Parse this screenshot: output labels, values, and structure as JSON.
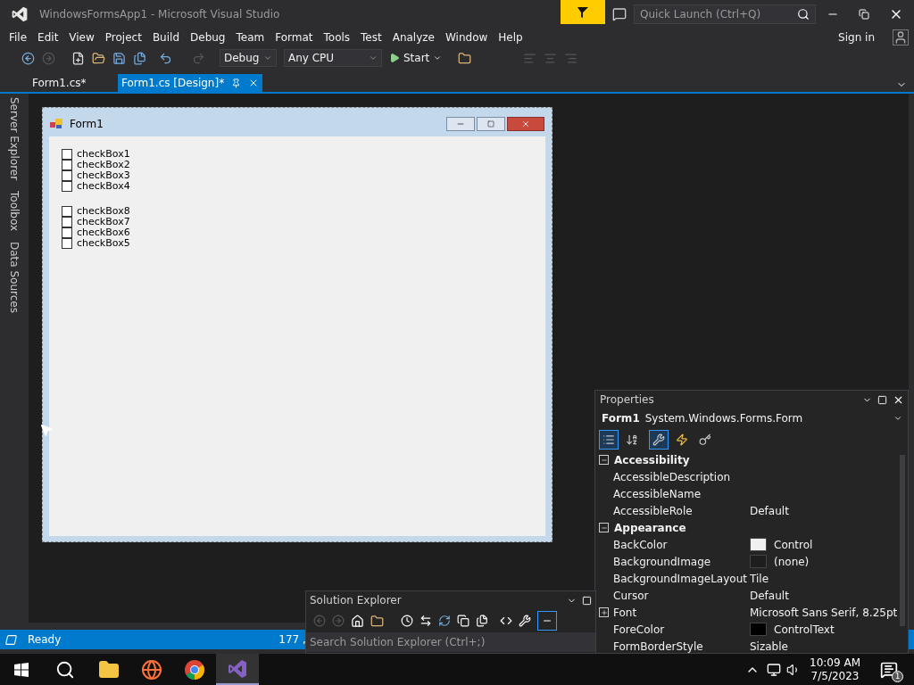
{
  "window": {
    "title": "WindowsFormsApp1 - Microsoft Visual Studio",
    "quick_launch": {
      "placeholder": "Quick Launch (Ctrl+Q)"
    }
  },
  "menu": [
    "File",
    "Edit",
    "View",
    "Project",
    "Build",
    "Debug",
    "Team",
    "Format",
    "Tools",
    "Test",
    "Analyze",
    "Window",
    "Help"
  ],
  "account": {
    "label": "Sign in"
  },
  "toolbar": {
    "configuration": "Debug",
    "platform": "Any CPU",
    "start": "Start"
  },
  "tabs": [
    {
      "label": "Form1.cs*",
      "selected": false
    },
    {
      "label": "Form1.cs [Design]*",
      "selected": true
    }
  ],
  "side_tabs": [
    "Server Explorer",
    "Toolbox",
    "Data Sources"
  ],
  "form": {
    "title": "Form1",
    "checkbox_groups": [
      [
        {
          "label": "checkBox1",
          "checked": false
        },
        {
          "label": "checkBox2",
          "checked": false
        },
        {
          "label": "checkBox3",
          "checked": false
        },
        {
          "label": "checkBox4",
          "checked": false
        }
      ],
      [
        {
          "label": "checkBox8",
          "checked": false
        },
        {
          "label": "checkBox7",
          "checked": false
        },
        {
          "label": "checkBox6",
          "checked": false
        },
        {
          "label": "checkBox5",
          "checked": false
        }
      ]
    ]
  },
  "properties": {
    "title": "Properties",
    "object": "Form1",
    "type": "System.Windows.Forms.Form",
    "view_buttons": [
      {
        "kind": "categorized",
        "selected": true
      },
      {
        "kind": "alphabetical",
        "selected": false
      },
      {
        "kind": "properties",
        "selected": true
      },
      {
        "kind": "events",
        "selected": false
      },
      {
        "kind": "pages",
        "selected": false
      }
    ],
    "categories": [
      {
        "name": "Accessibility",
        "expanded": true,
        "rows": [
          {
            "name": "AccessibleDescription",
            "value": ""
          },
          {
            "name": "AccessibleName",
            "value": ""
          },
          {
            "name": "AccessibleRole",
            "value": "Default"
          }
        ]
      },
      {
        "name": "Appearance",
        "expanded": true,
        "rows": [
          {
            "name": "BackColor",
            "value": "Control",
            "color": "#f0f0f0"
          },
          {
            "name": "BackgroundImage",
            "value": "(none)",
            "color": "#1e1e1e"
          },
          {
            "name": "BackgroundImageLayout",
            "value": "Tile"
          },
          {
            "name": "Cursor",
            "value": "Default"
          },
          {
            "name": "Font",
            "value": "Microsoft Sans Serif, 8.25pt",
            "expandable": true
          },
          {
            "name": "ForeColor",
            "value": "ControlText",
            "color": "#000000"
          },
          {
            "name": "FormBorderStyle",
            "value": "Sizable"
          }
        ]
      }
    ]
  },
  "solution_explorer": {
    "title": "Solution Explorer",
    "search": {
      "placeholder": "Search Solution Explorer (Ctrl+;)"
    }
  },
  "status_bar": {
    "text": "Ready",
    "position": "177 ,"
  },
  "taskbar": {
    "apps": [
      {
        "kind": "explorer",
        "selected": false
      },
      {
        "kind": "firefox",
        "selected": false
      },
      {
        "kind": "chrome",
        "selected": false
      },
      {
        "kind": "vs",
        "selected": true
      }
    ],
    "time": "10:09 AM",
    "date": "7/5/2023",
    "notifications": "1"
  }
}
